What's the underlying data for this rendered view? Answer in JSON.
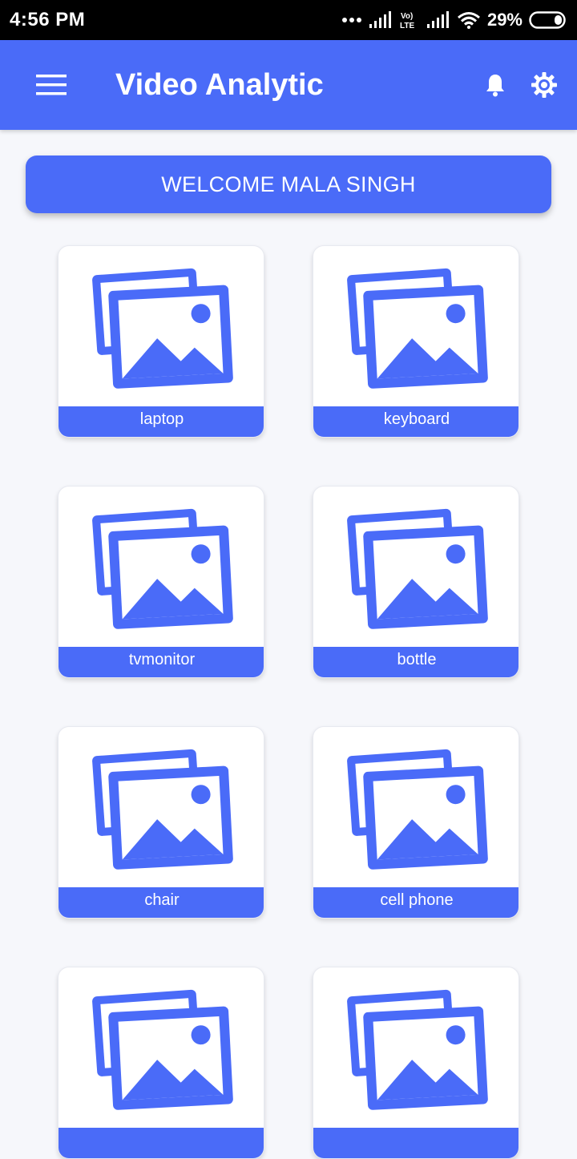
{
  "status_bar": {
    "time": "4:56 PM",
    "battery": "29%",
    "icons": [
      "more-dots-icon",
      "signal-icon",
      "volte-lte-icon",
      "signal-icon",
      "wifi-icon",
      "battery-icon"
    ]
  },
  "app_bar": {
    "title": "Video Analytic",
    "menu_icon": "hamburger-menu-icon",
    "notification_icon": "bell-icon",
    "settings_icon": "gear-icon"
  },
  "welcome": {
    "text": "WELCOME MALA SINGH"
  },
  "items": [
    {
      "label": "laptop",
      "icon": "image-gallery-icon"
    },
    {
      "label": "keyboard",
      "icon": "image-gallery-icon"
    },
    {
      "label": "tvmonitor",
      "icon": "image-gallery-icon"
    },
    {
      "label": "bottle",
      "icon": "image-gallery-icon"
    },
    {
      "label": "chair",
      "icon": "image-gallery-icon"
    },
    {
      "label": "cell phone",
      "icon": "image-gallery-icon"
    },
    {
      "label": "",
      "icon": "image-gallery-icon"
    },
    {
      "label": "",
      "icon": "image-gallery-icon"
    }
  ],
  "colors": {
    "primary": "#4a6bf8",
    "background": "#f6f7fb",
    "status_bar": "#000000"
  }
}
